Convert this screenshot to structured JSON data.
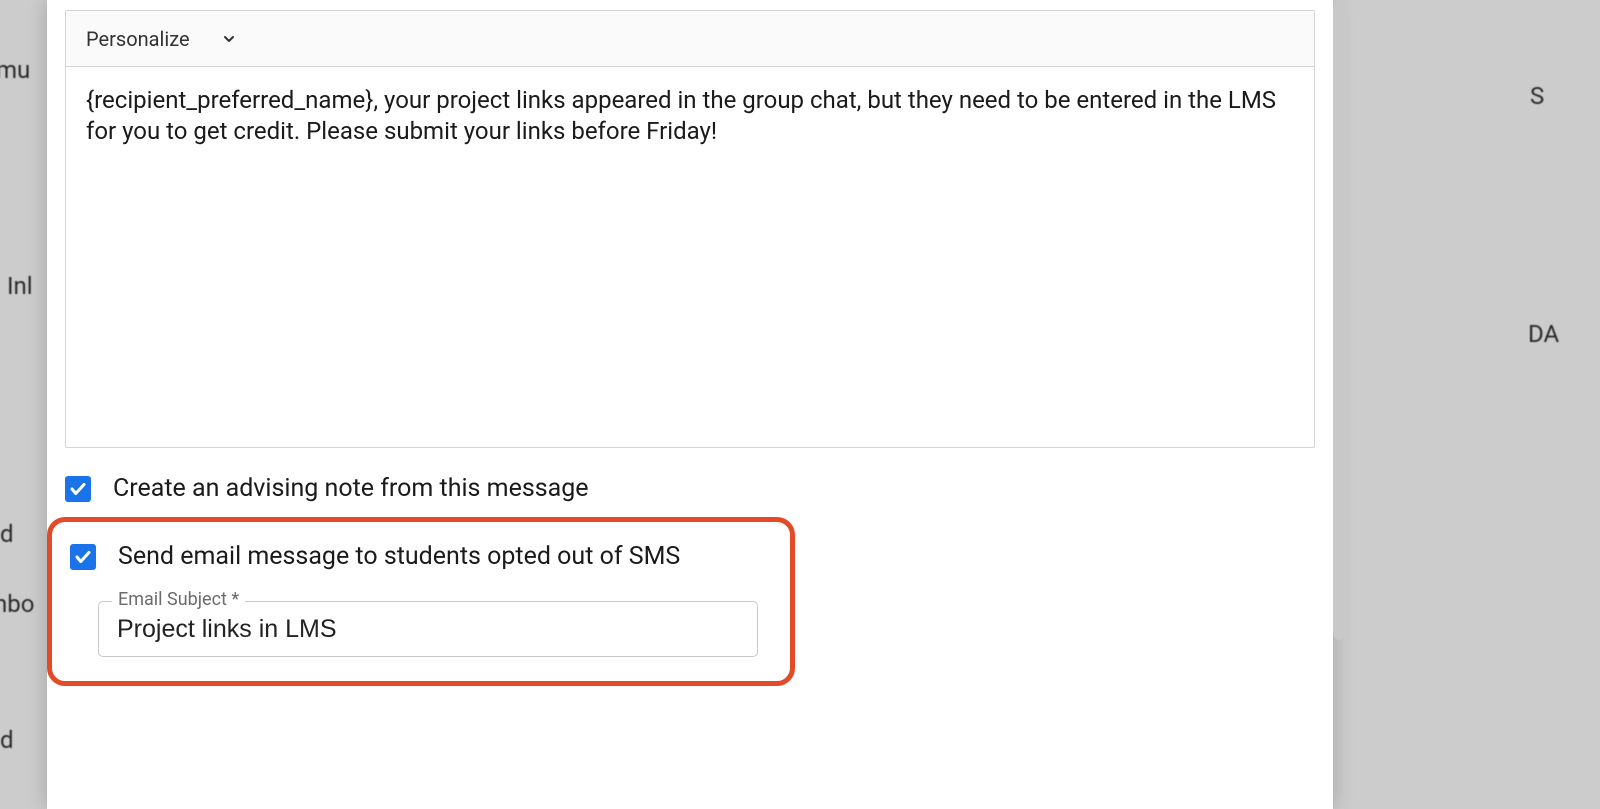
{
  "background": {
    "frag1": "mu",
    "frag2": "Inl",
    "frag3": "d",
    "frag4": "nbo",
    "frag5": "d",
    "frag6": "S",
    "frag7": "DA"
  },
  "editor": {
    "toolbar": {
      "personalize_label": "Personalize"
    },
    "body_text": "{recipient_preferred_name}, your project links appeared in the group chat, but they need to be entered in the LMS for you to get credit. Please submit your links before Friday!"
  },
  "options": {
    "create_note": {
      "checked": true,
      "label": "Create an advising note from this message"
    },
    "send_email_optout": {
      "checked": true,
      "label": "Send email message to students opted out of SMS"
    },
    "email_subject": {
      "label": "Email Subject *",
      "value": "Project links in LMS"
    }
  }
}
